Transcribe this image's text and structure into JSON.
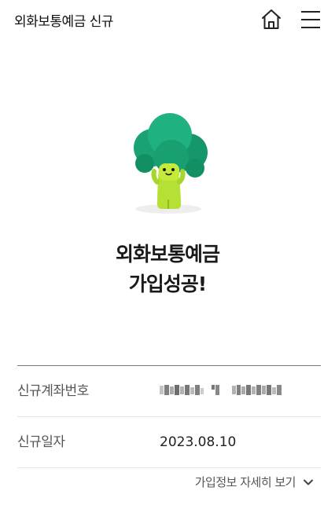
{
  "header": {
    "title": "외화보통예금 신규"
  },
  "result": {
    "line1": "외화보통예금",
    "line2": "가입성공!"
  },
  "info": {
    "rows": [
      {
        "label": "신규계좌번호",
        "value": ""
      },
      {
        "label": "신규일자",
        "value": "2023.08.10"
      }
    ]
  },
  "detail_link": {
    "label": "가입정보 자세히 보기"
  },
  "colors": {
    "broccoli_head": "#1aaa78",
    "broccoli_body": "#b6e034",
    "text_primary": "#1a1a1a",
    "text_secondary": "#555555"
  },
  "icons": {
    "home": "home-icon",
    "menu": "hamburger-menu-icon",
    "chevron": "chevron-down-icon"
  }
}
